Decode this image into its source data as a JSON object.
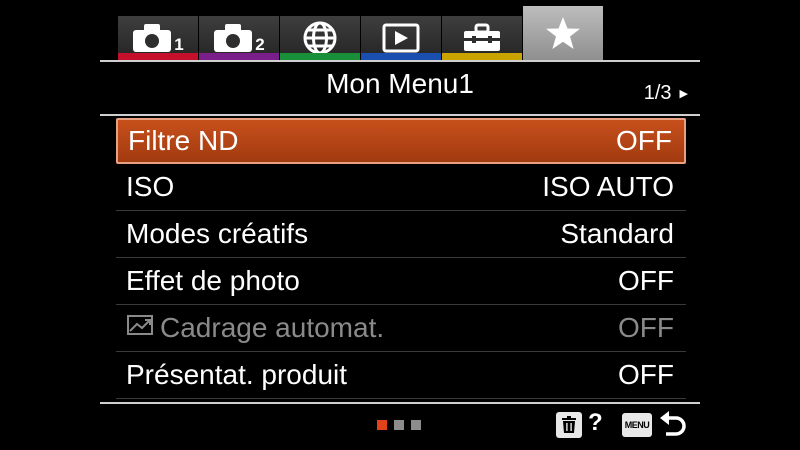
{
  "tabs": [
    {
      "icon": "camera-icon",
      "num": "1",
      "color": "#c4102a",
      "active": false
    },
    {
      "icon": "camera-icon",
      "num": "2",
      "color": "#7a1f8a",
      "active": false
    },
    {
      "icon": "globe-icon",
      "num": "",
      "color": "#1a8f3a",
      "active": false
    },
    {
      "icon": "play-icon",
      "num": "",
      "color": "#1a4fb0",
      "active": false
    },
    {
      "icon": "toolbox-icon",
      "num": "",
      "color": "#c9a400",
      "active": false
    },
    {
      "icon": "star-icon",
      "num": "",
      "color": "#9a9a9a",
      "active": true
    }
  ],
  "header": {
    "title": "Mon Menu1",
    "page": "1/3"
  },
  "menu": [
    {
      "label": "Filtre ND",
      "value": "OFF",
      "selected": true,
      "disabled": false
    },
    {
      "label": "ISO",
      "value": "ISO AUTO",
      "selected": false,
      "disabled": false
    },
    {
      "label": "Modes créatifs",
      "value": "Standard",
      "selected": false,
      "disabled": false
    },
    {
      "label": "Effet de photo",
      "value": "OFF",
      "selected": false,
      "disabled": false
    },
    {
      "label": "Cadrage automat.",
      "value": "OFF",
      "selected": false,
      "disabled": true,
      "icon": "auto-framing-icon"
    },
    {
      "label": "Présentat. produit",
      "value": "OFF",
      "selected": false,
      "disabled": false
    }
  ],
  "footer": {
    "page_dots": [
      "#e0421a",
      "#8c8c8c",
      "#8c8c8c"
    ],
    "help": "?",
    "menu_label": "MENU"
  }
}
